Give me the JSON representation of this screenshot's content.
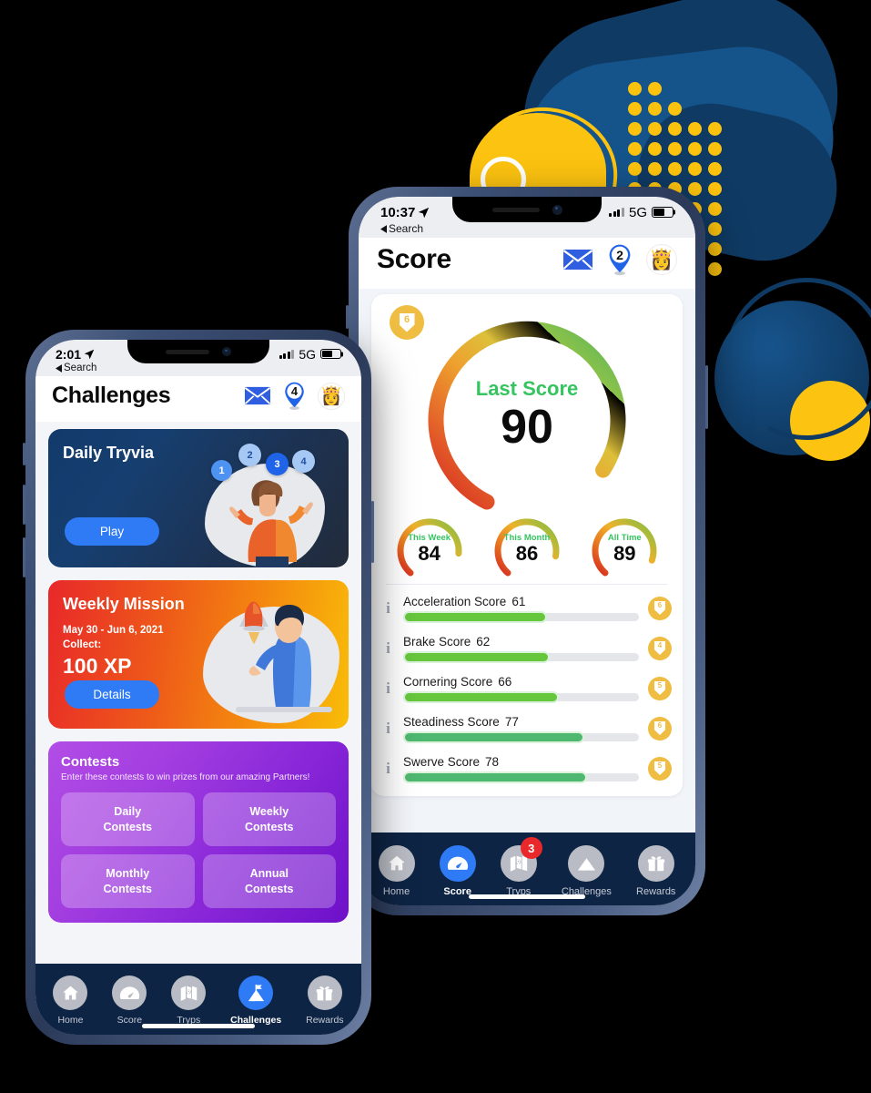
{
  "background": {
    "color": "#000000"
  },
  "decor": {
    "navy": "#0f3a63",
    "navy_light": "#16558d",
    "yellow": "#fcc310",
    "dot_color": "#fcc30e"
  },
  "phone_right": {
    "name": "Score screen",
    "statusbar": {
      "time": "10:37",
      "back_label": "Search",
      "network": "5G",
      "location_arrow_icon": "location-arrow-icon",
      "signal_icon": "signal-bars-icon",
      "battery_icon": "battery-icon"
    },
    "header": {
      "title": "Score",
      "mail_icon": "envelope-icon",
      "pin_icon": "map-pin-icon",
      "pin_badge": "2",
      "avatar_icon": "avatar-icon",
      "avatar_glyph": "👸"
    },
    "score_card": {
      "level_badge": "6",
      "gauge": {
        "label": "Last Score",
        "value": "90",
        "label_color": "#35c45f",
        "max": 100
      },
      "mini_gauges": [
        {
          "label": "This Week",
          "value": "84",
          "pct": 84
        },
        {
          "label": "This Month",
          "value": "86",
          "pct": 86
        },
        {
          "label": "All Time",
          "value": "89",
          "pct": 89
        }
      ],
      "rows": [
        {
          "label": "Acceleration Score",
          "value": "61",
          "pct": 61,
          "badge": "6",
          "bar_color": "#66c63c"
        },
        {
          "label": "Brake Score",
          "value": "62",
          "pct": 62,
          "badge": "4",
          "bar_color": "#66c63c"
        },
        {
          "label": "Cornering Score",
          "value": "66",
          "pct": 66,
          "badge": "5",
          "bar_color": "#66c63c"
        },
        {
          "label": "Steadiness Score",
          "value": "77",
          "pct": 77,
          "badge": "6",
          "bar_color": "#4eb770"
        },
        {
          "label": "Swerve Score",
          "value": "78",
          "pct": 78,
          "badge": "5",
          "bar_color": "#4eb770"
        }
      ],
      "info_icon": "info-icon"
    },
    "bottom_nav": [
      {
        "label": "Home",
        "icon": "home-icon",
        "active": false,
        "badge": ""
      },
      {
        "label": "Score",
        "icon": "gauge-icon",
        "active": true,
        "badge": ""
      },
      {
        "label": "Tryps",
        "icon": "map-icon",
        "active": false,
        "badge": "3"
      },
      {
        "label": "Challenges",
        "icon": "mountain-icon",
        "active": false,
        "badge": ""
      },
      {
        "label": "Rewards",
        "icon": "gift-icon",
        "active": false,
        "badge": ""
      }
    ]
  },
  "phone_left": {
    "name": "Challenges screen",
    "statusbar": {
      "time": "2:01",
      "back_label": "Search",
      "network": "5G",
      "location_arrow_icon": "location-arrow-icon",
      "signal_icon": "signal-bars-icon",
      "battery_icon": "battery-icon"
    },
    "header": {
      "title": "Challenges",
      "mail_icon": "envelope-icon",
      "pin_icon": "map-pin-icon",
      "pin_badge": "4",
      "avatar_icon": "avatar-icon",
      "avatar_glyph": "👸"
    },
    "trivia_card": {
      "title": "Daily Tryvia",
      "button": "Play",
      "bubbles": [
        "1",
        "2",
        "3",
        "4"
      ],
      "illustration_icon": "woman-juggling-illustration"
    },
    "mission_card": {
      "title": "Weekly Mission",
      "dates": "May 30 - Jun 6, 2021",
      "collect_label": "Collect:",
      "xp": "100 XP",
      "button": "Details",
      "illustration_icon": "man-rocket-illustration"
    },
    "contests_card": {
      "title": "Contests",
      "subtitle": "Enter these contests to win prizes from our amazing Partners!",
      "tiles": [
        {
          "line1": "Daily",
          "line2": "Contests"
        },
        {
          "line1": "Weekly",
          "line2": "Contests"
        },
        {
          "line1": "Monthly",
          "line2": "Contests"
        },
        {
          "line1": "Annual",
          "line2": "Contests"
        }
      ]
    },
    "bottom_nav": [
      {
        "label": "Home",
        "icon": "home-icon",
        "active": false,
        "badge": ""
      },
      {
        "label": "Score",
        "icon": "gauge-icon",
        "active": false,
        "badge": ""
      },
      {
        "label": "Tryps",
        "icon": "map-icon",
        "active": false,
        "badge": ""
      },
      {
        "label": "Challenges",
        "icon": "mountain-icon",
        "active": true,
        "badge": ""
      },
      {
        "label": "Rewards",
        "icon": "gift-icon",
        "active": false,
        "badge": ""
      }
    ]
  }
}
